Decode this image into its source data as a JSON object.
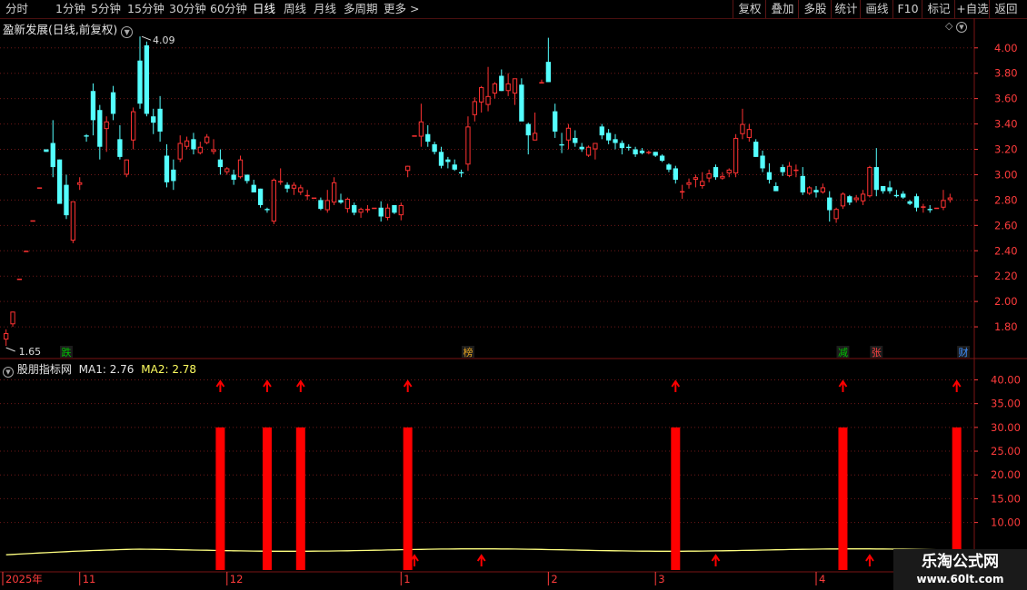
{
  "toolbar": {
    "periods": [
      "分时",
      "1分钟",
      "5分钟",
      "15分钟",
      "30分钟",
      "60分钟",
      "日线",
      "周线",
      "月线",
      "多周期",
      "更多"
    ],
    "active_period": "日线",
    "more_arrow": ">",
    "actions": [
      "复权",
      "叠加",
      "多股",
      "统计",
      "画线",
      "F10",
      "标记",
      "+自选",
      "返回"
    ]
  },
  "main_panel": {
    "title": "盈新发展(日线,前复权)",
    "high_label": "4.09",
    "low_label": "1.65",
    "price_axis_ticks": [
      "4.00",
      "3.80",
      "3.60",
      "3.40",
      "3.20",
      "3.00",
      "2.80",
      "2.60",
      "2.40",
      "2.20",
      "2.00",
      "1.80"
    ],
    "markers": [
      {
        "text": "跌",
        "color": "#00c000",
        "after_bar": 9
      },
      {
        "text": "榜",
        "color": "#e0a020",
        "after_bar": 69
      },
      {
        "text": "减",
        "color": "#00c000",
        "after_bar": 125
      },
      {
        "text": "张",
        "color": "#ff4040",
        "after_bar": 130
      },
      {
        "text": "财",
        "color": "#4090ff",
        "after_bar": 143
      }
    ]
  },
  "indicator_panel": {
    "title": "股朋指标网",
    "ma1_label": "MA1: 2.76",
    "ma2_label": "MA2: 2.78",
    "axis_ticks": [
      "40.00",
      "35.00",
      "30.00",
      "25.00",
      "20.00",
      "15.00",
      "10.00"
    ],
    "signal_bars": [
      {
        "after_bar": 32,
        "value": 30
      },
      {
        "after_bar": 39,
        "value": 30
      },
      {
        "after_bar": 44,
        "value": 30
      },
      {
        "after_bar": 60,
        "value": 30
      },
      {
        "after_bar": 100,
        "value": 30
      },
      {
        "after_bar": 125,
        "value": 30
      },
      {
        "after_bar": 142,
        "value": 30
      }
    ],
    "small_arrows_after_bar": [
      61,
      71,
      106,
      129
    ]
  },
  "date_axis": {
    "labels": [
      {
        "text": "2025年",
        "after_bar": 0
      },
      {
        "text": "11",
        "after_bar": 11
      },
      {
        "text": "12",
        "after_bar": 33
      },
      {
        "text": "1",
        "after_bar": 59
      },
      {
        "text": "2",
        "after_bar": 81
      },
      {
        "text": "3",
        "after_bar": 97
      },
      {
        "text": "4",
        "after_bar": 121
      }
    ]
  },
  "watermark": {
    "title": "乐淘公式网",
    "url": "www.60lt.com"
  },
  "colors": {
    "up": "#ff3232",
    "down": "#54ffff",
    "signal": "#ff0000",
    "ma_line": "#ffff80",
    "grid": "#6e1818",
    "axis_text": "#ff3c3c"
  },
  "chart_data": {
    "type": "candlestick",
    "y_range": [
      1.6,
      4.12
    ],
    "ohlc": [
      [
        1.7,
        1.78,
        1.65,
        1.75
      ],
      [
        1.82,
        1.92,
        1.8,
        1.92
      ],
      [
        2.18,
        2.18,
        2.18,
        2.18
      ],
      [
        2.4,
        2.4,
        2.4,
        2.4
      ],
      [
        2.64,
        2.64,
        2.64,
        2.64
      ],
      [
        2.9,
        2.9,
        2.9,
        2.9
      ],
      [
        3.2,
        3.2,
        3.18,
        3.18
      ],
      [
        3.25,
        3.43,
        2.98,
        3.06
      ],
      [
        3.12,
        3.12,
        2.78,
        2.77
      ],
      [
        2.92,
        3.0,
        2.65,
        2.68
      ],
      [
        2.48,
        2.74,
        2.46,
        2.79
      ],
      [
        2.92,
        2.98,
        2.88,
        2.94
      ],
      [
        3.31,
        3.32,
        3.26,
        3.3
      ],
      [
        3.66,
        3.72,
        3.31,
        3.43
      ],
      [
        3.51,
        3.55,
        3.12,
        3.22
      ],
      [
        3.36,
        3.46,
        3.18,
        3.42
      ],
      [
        3.65,
        3.7,
        3.43,
        3.48
      ],
      [
        3.28,
        3.39,
        3.12,
        3.14
      ],
      [
        3.0,
        3.12,
        2.98,
        3.12
      ],
      [
        3.27,
        3.53,
        3.2,
        3.5
      ],
      [
        3.9,
        4.09,
        3.52,
        3.56
      ],
      [
        4.02,
        4.05,
        3.46,
        3.48
      ],
      [
        3.46,
        3.52,
        3.32,
        3.41
      ],
      [
        3.52,
        3.62,
        3.26,
        3.34
      ],
      [
        3.15,
        3.24,
        2.9,
        2.94
      ],
      [
        3.04,
        3.12,
        2.88,
        2.95
      ],
      [
        3.12,
        3.31,
        3.1,
        3.25
      ],
      [
        3.22,
        3.3,
        3.2,
        3.27
      ],
      [
        3.28,
        3.33,
        3.16,
        3.2
      ],
      [
        3.17,
        3.26,
        3.16,
        3.22
      ],
      [
        3.25,
        3.32,
        3.24,
        3.3
      ],
      [
        3.18,
        3.28,
        3.16,
        3.2
      ],
      [
        3.12,
        3.2,
        3.0,
        3.06
      ],
      [
        3.02,
        3.06,
        3.0,
        3.05
      ],
      [
        3.0,
        3.04,
        2.92,
        2.96
      ],
      [
        2.98,
        3.15,
        2.97,
        3.12
      ],
      [
        3.0,
        3.0,
        2.93,
        2.95
      ],
      [
        2.92,
        2.96,
        2.86,
        2.86
      ],
      [
        2.89,
        2.89,
        2.74,
        2.76
      ],
      [
        2.73,
        2.74,
        2.7,
        2.72
      ],
      [
        2.63,
        2.97,
        2.61,
        2.96
      ],
      [
        2.94,
        3.05,
        2.92,
        2.95
      ],
      [
        2.92,
        2.94,
        2.86,
        2.89
      ],
      [
        2.89,
        2.94,
        2.84,
        2.92
      ],
      [
        2.86,
        2.92,
        2.84,
        2.9
      ],
      [
        2.84,
        2.88,
        2.8,
        2.84
      ],
      [
        2.82,
        2.82,
        2.82,
        2.82
      ],
      [
        2.8,
        2.82,
        2.72,
        2.73
      ],
      [
        2.72,
        2.88,
        2.7,
        2.8
      ],
      [
        2.78,
        2.98,
        2.76,
        2.94
      ],
      [
        2.8,
        2.85,
        2.77,
        2.78
      ],
      [
        2.73,
        2.82,
        2.7,
        2.81
      ],
      [
        2.76,
        2.78,
        2.68,
        2.7
      ],
      [
        2.7,
        2.74,
        2.66,
        2.73
      ],
      [
        2.73,
        2.76,
        2.7,
        2.73
      ],
      [
        2.74,
        2.74,
        2.74,
        2.74
      ],
      [
        2.74,
        2.79,
        2.63,
        2.67
      ],
      [
        2.66,
        2.77,
        2.64,
        2.74
      ],
      [
        2.76,
        2.76,
        2.69,
        2.7
      ],
      [
        2.68,
        2.78,
        2.64,
        2.76
      ],
      [
        3.03,
        3.07,
        2.98,
        3.07
      ],
      [
        3.31,
        3.31,
        3.31,
        3.31
      ],
      [
        3.3,
        3.56,
        3.22,
        3.42
      ],
      [
        3.32,
        3.39,
        3.22,
        3.26
      ],
      [
        3.24,
        3.26,
        3.16,
        3.18
      ],
      [
        3.18,
        3.22,
        3.05,
        3.07
      ],
      [
        3.12,
        3.14,
        3.05,
        3.1
      ],
      [
        3.08,
        3.12,
        3.03,
        3.04
      ],
      [
        3.02,
        3.04,
        2.98,
        3.01
      ],
      [
        3.08,
        3.46,
        3.03,
        3.38
      ],
      [
        3.47,
        3.61,
        3.42,
        3.58
      ],
      [
        3.57,
        3.7,
        3.49,
        3.69
      ],
      [
        3.55,
        3.85,
        3.5,
        3.62
      ],
      [
        3.64,
        3.73,
        3.6,
        3.72
      ],
      [
        3.78,
        3.83,
        3.66,
        3.66
      ],
      [
        3.66,
        3.8,
        3.62,
        3.72
      ],
      [
        3.64,
        3.75,
        3.55,
        3.76
      ],
      [
        3.71,
        3.76,
        3.44,
        3.42
      ],
      [
        3.4,
        3.41,
        3.16,
        3.31
      ],
      [
        3.27,
        3.49,
        3.27,
        3.33
      ],
      [
        3.73,
        3.75,
        3.73,
        3.73
      ],
      [
        3.89,
        4.08,
        3.73,
        3.73
      ],
      [
        3.5,
        3.56,
        3.29,
        3.34
      ],
      [
        3.24,
        3.33,
        3.17,
        3.23
      ],
      [
        3.27,
        3.4,
        3.2,
        3.37
      ],
      [
        3.29,
        3.35,
        3.22,
        3.25
      ],
      [
        3.22,
        3.25,
        3.18,
        3.2
      ],
      [
        3.15,
        3.23,
        3.14,
        3.22
      ],
      [
        3.2,
        3.25,
        3.12,
        3.25
      ],
      [
        3.38,
        3.4,
        3.28,
        3.31
      ],
      [
        3.33,
        3.36,
        3.24,
        3.27
      ],
      [
        3.28,
        3.32,
        3.2,
        3.25
      ],
      [
        3.25,
        3.27,
        3.16,
        3.21
      ],
      [
        3.22,
        3.24,
        3.19,
        3.21
      ],
      [
        3.2,
        3.22,
        3.14,
        3.16
      ],
      [
        3.19,
        3.21,
        3.16,
        3.17
      ],
      [
        3.17,
        3.19,
        3.16,
        3.18
      ],
      [
        3.18,
        3.18,
        3.14,
        3.15
      ],
      [
        3.15,
        3.16,
        3.1,
        3.11
      ],
      [
        3.08,
        3.09,
        3.02,
        3.04
      ],
      [
        3.05,
        3.07,
        2.93,
        2.96
      ],
      [
        2.86,
        2.92,
        2.81,
        2.87
      ],
      [
        2.92,
        2.97,
        2.89,
        2.94
      ],
      [
        2.96,
        3.0,
        2.9,
        2.98
      ],
      [
        2.91,
        3.02,
        2.89,
        2.95
      ],
      [
        2.97,
        3.04,
        2.94,
        3.01
      ],
      [
        3.06,
        3.08,
        2.96,
        2.98
      ],
      [
        2.97,
        3.02,
        2.96,
        2.99
      ],
      [
        3.01,
        3.05,
        2.98,
        3.04
      ],
      [
        3.01,
        3.32,
        2.98,
        3.29
      ],
      [
        3.32,
        3.52,
        3.28,
        3.4
      ],
      [
        3.29,
        3.4,
        3.26,
        3.36
      ],
      [
        3.26,
        3.28,
        3.14,
        3.14
      ],
      [
        3.15,
        3.19,
        3.02,
        3.05
      ],
      [
        3.02,
        3.09,
        2.93,
        2.96
      ],
      [
        2.91,
        2.94,
        2.87,
        2.87
      ],
      [
        3.06,
        3.08,
        2.99,
        3.02
      ],
      [
        2.99,
        3.1,
        2.98,
        3.07
      ],
      [
        3.04,
        3.08,
        2.98,
        3.04
      ],
      [
        2.99,
        3.06,
        2.84,
        2.86
      ],
      [
        2.85,
        2.91,
        2.84,
        2.9
      ],
      [
        2.88,
        2.91,
        2.82,
        2.86
      ],
      [
        2.86,
        2.93,
        2.85,
        2.9
      ],
      [
        2.82,
        2.87,
        2.63,
        2.72
      ],
      [
        2.65,
        2.74,
        2.62,
        2.73
      ],
      [
        2.75,
        2.86,
        2.73,
        2.85
      ],
      [
        2.83,
        2.84,
        2.76,
        2.78
      ],
      [
        2.8,
        2.84,
        2.78,
        2.82
      ],
      [
        2.79,
        2.88,
        2.76,
        2.85
      ],
      [
        2.83,
        3.07,
        2.82,
        3.06
      ],
      [
        3.06,
        3.21,
        2.83,
        2.88
      ],
      [
        2.91,
        2.91,
        2.85,
        2.87
      ],
      [
        2.9,
        2.95,
        2.85,
        2.87
      ],
      [
        2.84,
        2.88,
        2.82,
        2.83
      ],
      [
        2.85,
        2.87,
        2.81,
        2.82
      ],
      [
        2.79,
        2.8,
        2.76,
        2.77
      ],
      [
        2.83,
        2.85,
        2.71,
        2.74
      ],
      [
        2.75,
        2.77,
        2.7,
        2.75
      ],
      [
        2.73,
        2.76,
        2.7,
        2.72
      ],
      [
        2.74,
        2.74,
        2.74,
        2.74
      ],
      [
        2.74,
        2.88,
        2.72,
        2.8
      ],
      [
        2.8,
        2.85,
        2.78,
        2.82
      ]
    ],
    "indicator_y_range": [
      0,
      42
    ],
    "ma_line_value": 4.2
  }
}
